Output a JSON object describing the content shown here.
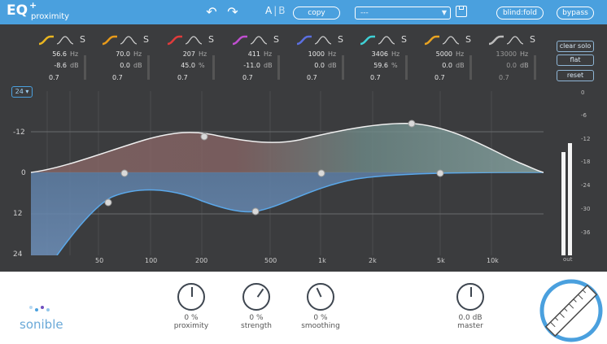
{
  "header": {
    "logo_text": "EQ",
    "logo_plus": "+",
    "product_name": "proximity",
    "ab_a": "A",
    "ab_b": "B",
    "copy_label": "copy",
    "preset_value": "---",
    "blindfold_label": "blind:fold",
    "bypass_label": "bypass"
  },
  "bands": [
    {
      "freq": "56.6",
      "freq_unit": "Hz",
      "gain": "-8.6",
      "gain_unit": "dB",
      "q": "0.7",
      "icon": "low-shelf-icon",
      "color": "#e9b521",
      "solo": "S"
    },
    {
      "freq": "70.0",
      "freq_unit": "Hz",
      "gain": "0.0",
      "gain_unit": "dB",
      "q": "0.7",
      "icon": "proximity-low-icon",
      "color": "#e89a1a",
      "solo": "S"
    },
    {
      "freq": "207",
      "freq_unit": "Hz",
      "gain": "45.0",
      "gain_unit": "%",
      "q": "0.7",
      "icon": "bell-red-icon",
      "color": "#e03b3b",
      "solo": "S"
    },
    {
      "freq": "411",
      "freq_unit": "Hz",
      "gain": "-11.0",
      "gain_unit": "dB",
      "q": "0.7",
      "icon": "bell-magenta-icon",
      "color": "#c04fd0",
      "solo": "S"
    },
    {
      "freq": "1000",
      "freq_unit": "Hz",
      "gain": "0.0",
      "gain_unit": "dB",
      "q": "0.7",
      "icon": "bell-blue-icon",
      "color": "#5b6fe0",
      "solo": "S"
    },
    {
      "freq": "3406",
      "freq_unit": "Hz",
      "gain": "59.6",
      "gain_unit": "%",
      "q": "0.7",
      "icon": "bell-cyan-icon",
      "color": "#3fd1d6",
      "solo": "S"
    },
    {
      "freq": "5000",
      "freq_unit": "Hz",
      "gain": "0.0",
      "gain_unit": "dB",
      "q": "0.7",
      "icon": "high-proximity-icon",
      "color": "#e9a321",
      "solo": "S"
    },
    {
      "freq": "13000",
      "freq_unit": "Hz",
      "gain": "0.0",
      "gain_unit": "dB",
      "q": "0.7",
      "icon": "high-shelf-icon",
      "color": "#bbbbbb",
      "solo": "S"
    }
  ],
  "side_buttons": {
    "clear_solo": "clear solo",
    "flat": "flat",
    "reset": "reset"
  },
  "graph": {
    "range_label": "24 ▾",
    "db_labels": [
      "-12",
      "0",
      "12",
      "24"
    ],
    "freq_labels": [
      "50",
      "100",
      "200",
      "500",
      "1k",
      "2k",
      "5k",
      "10k"
    ]
  },
  "output_meter": {
    "scale": [
      "0",
      "-6",
      "-12",
      "-18",
      "-24",
      "-30",
      "-36"
    ],
    "label": "out",
    "levels": [
      0.74,
      0.8
    ]
  },
  "controls": {
    "proximity": {
      "value": "0 %",
      "label": "proximity"
    },
    "strength": {
      "value": "0 %",
      "label": "strength"
    },
    "smoothing": {
      "value": "0 %",
      "label": "smoothing"
    },
    "master": {
      "value": "0.0 dB",
      "label": "master"
    }
  },
  "brand": "sonible"
}
